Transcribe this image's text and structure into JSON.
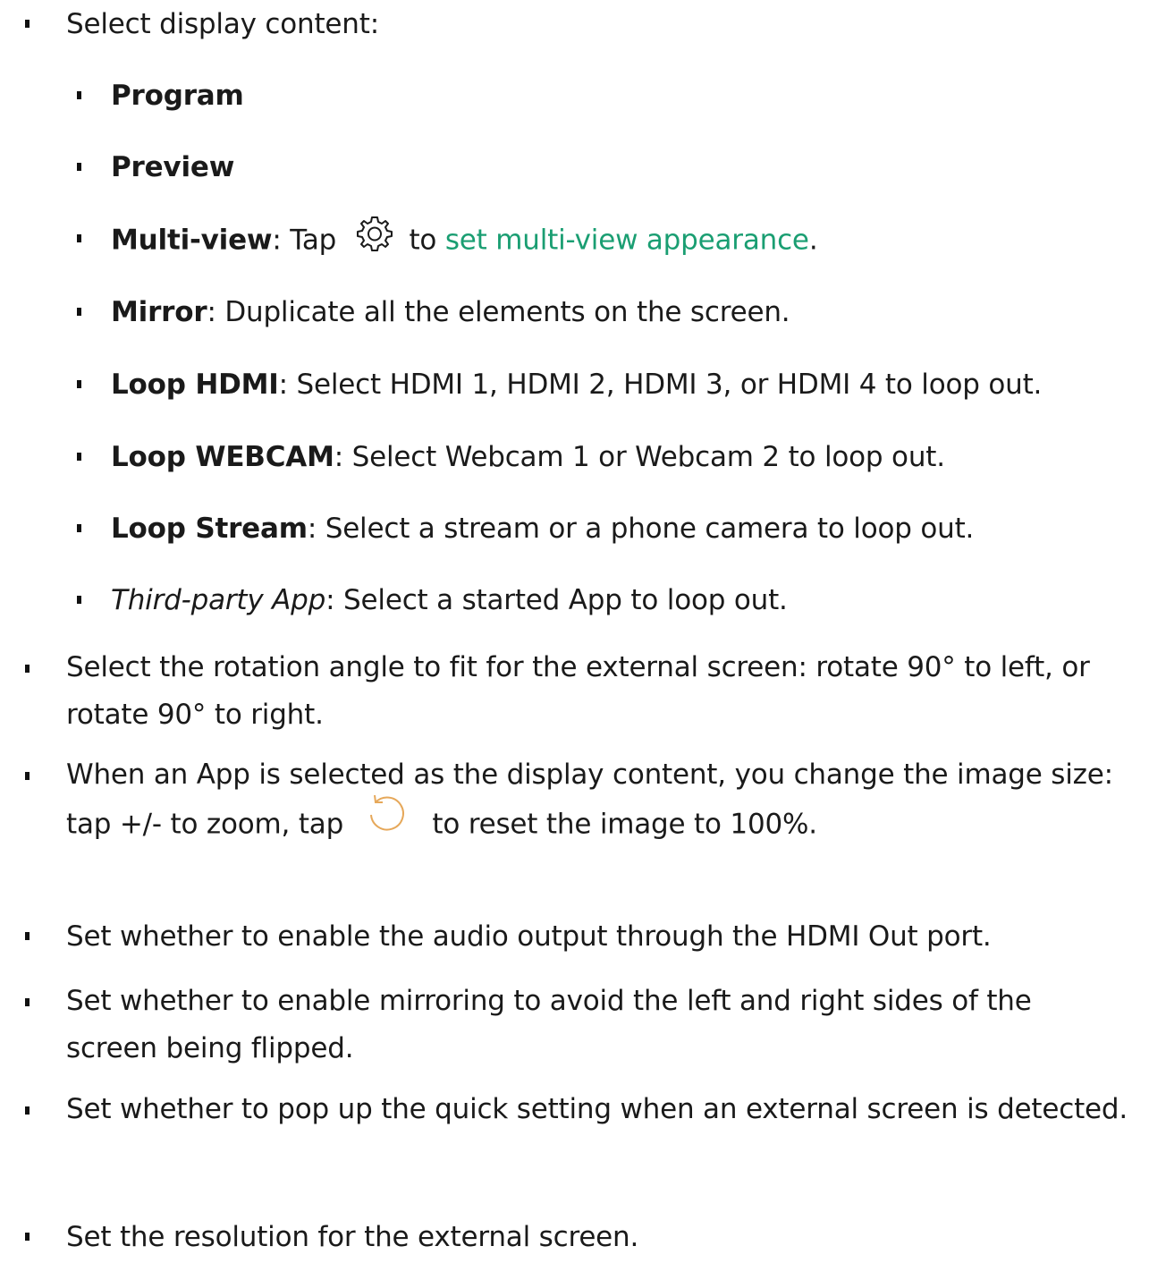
{
  "items": [
    {
      "text": "Select display content:"
    },
    {
      "bold": "Program"
    },
    {
      "bold": "Preview"
    },
    {
      "bold": "Multi-view",
      "pre": ": Tap ",
      "mid": " to ",
      "link": "set multi-view appearance",
      "post": "."
    },
    {
      "bold": "Mirror",
      "text": ": Duplicate all the elements on the screen."
    },
    {
      "bold": "Loop HDMI",
      "text": ": Select HDMI 1, HDMI 2, HDMI 3, or HDMI 4 to loop out."
    },
    {
      "bold": "Loop WEBCAM",
      "text": ": Select Webcam 1 or Webcam 2 to loop out."
    },
    {
      "bold": "Loop Stream",
      "text": ": Select a stream or a phone camera to loop out."
    },
    {
      "italic": "Third-party App",
      "text": ": Select a started App to loop out."
    },
    {
      "text": "Select the rotation angle to fit for the external screen: rotate 90° to left, or rotate 90° to right."
    },
    {
      "pre": "When an App is selected as the display content, you change the image size: tap +/- to zoom, tap ",
      "post": " to reset the image to 100%."
    },
    {
      "text": "Set whether to enable the audio output through the HDMI Out port."
    },
    {
      "text": "Set whether to enable mirroring to avoid the left and right sides of the screen being flipped."
    },
    {
      "text": "Set whether to pop up the quick setting when an external screen is detected."
    },
    {
      "text": "Set the resolution for the external screen."
    }
  ],
  "icons": {
    "gear": "gear-icon",
    "reset": "reset-icon",
    "accent": "#1a9e72",
    "reset_color": "#e6a85a"
  }
}
